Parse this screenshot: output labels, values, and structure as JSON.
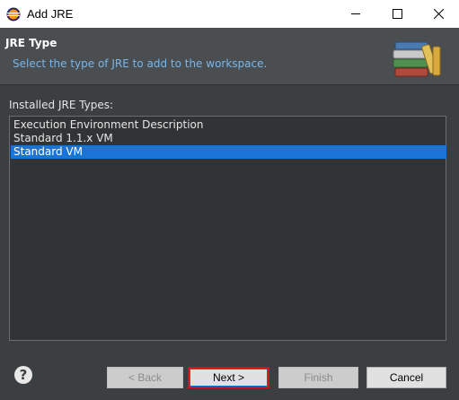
{
  "window": {
    "title": "Add JRE",
    "icon": "eclipse-icon"
  },
  "header": {
    "title": "JRE Type",
    "description": "Select the type of JRE to add to the workspace.",
    "graphic": "library-books-icon"
  },
  "list": {
    "label": "Installed JRE Types:",
    "items": [
      {
        "label": "Execution Environment Description",
        "selected": false
      },
      {
        "label": "Standard 1.1.x VM",
        "selected": false
      },
      {
        "label": "Standard VM",
        "selected": true
      }
    ]
  },
  "buttons": {
    "back": "< Back",
    "next": "Next >",
    "finish": "Finish",
    "cancel": "Cancel"
  },
  "help_icon": "?",
  "colors": {
    "selection": "#1a74d6",
    "header_link": "#78b6ea",
    "focus_highlight": "#d2141e"
  }
}
